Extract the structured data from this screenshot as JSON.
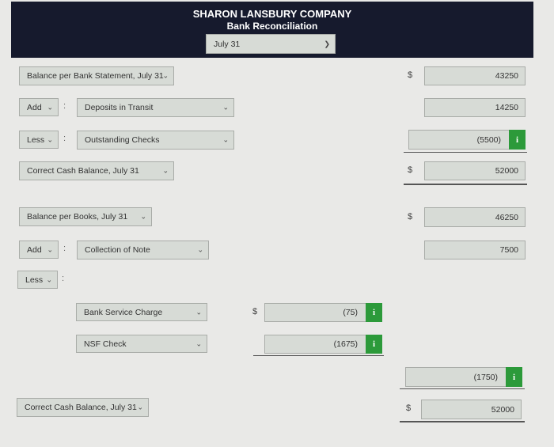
{
  "header": {
    "company": "SHARON LANSBURY COMPANY",
    "title": "Bank Reconciliation",
    "date_select": "July 31"
  },
  "rows": {
    "bank_balance": {
      "label": "Balance per Bank Statement, July 31",
      "value": "43250",
      "currency": "$"
    },
    "bank_add": {
      "op": "Add",
      "item": "Deposits in Transit",
      "value": "14250"
    },
    "bank_less": {
      "op": "Less",
      "item": "Outstanding Checks",
      "value": "(5500)"
    },
    "bank_correct": {
      "label": "Correct Cash Balance, July 31",
      "value": "52000",
      "currency": "$"
    },
    "book_balance": {
      "label": "Balance per Books, July 31",
      "value": "46250",
      "currency": "$"
    },
    "book_add": {
      "op": "Add",
      "item": "Collection of Note",
      "value": "7500"
    },
    "book_less": {
      "op": "Less"
    },
    "service_charge": {
      "item": "Bank Service Charge",
      "value": "(75)",
      "currency": "$"
    },
    "nsf": {
      "item": "NSF Check",
      "value": "(1675)"
    },
    "less_total": {
      "value": "(1750)"
    },
    "book_correct": {
      "label": "Correct Cash Balance, July 31",
      "value": "52000",
      "currency": "$"
    }
  },
  "icons": {
    "info": "i",
    "chevron": "⌄",
    "colon": ":"
  },
  "colors": {
    "header": "#161a2d",
    "info": "#2c9a3a"
  }
}
